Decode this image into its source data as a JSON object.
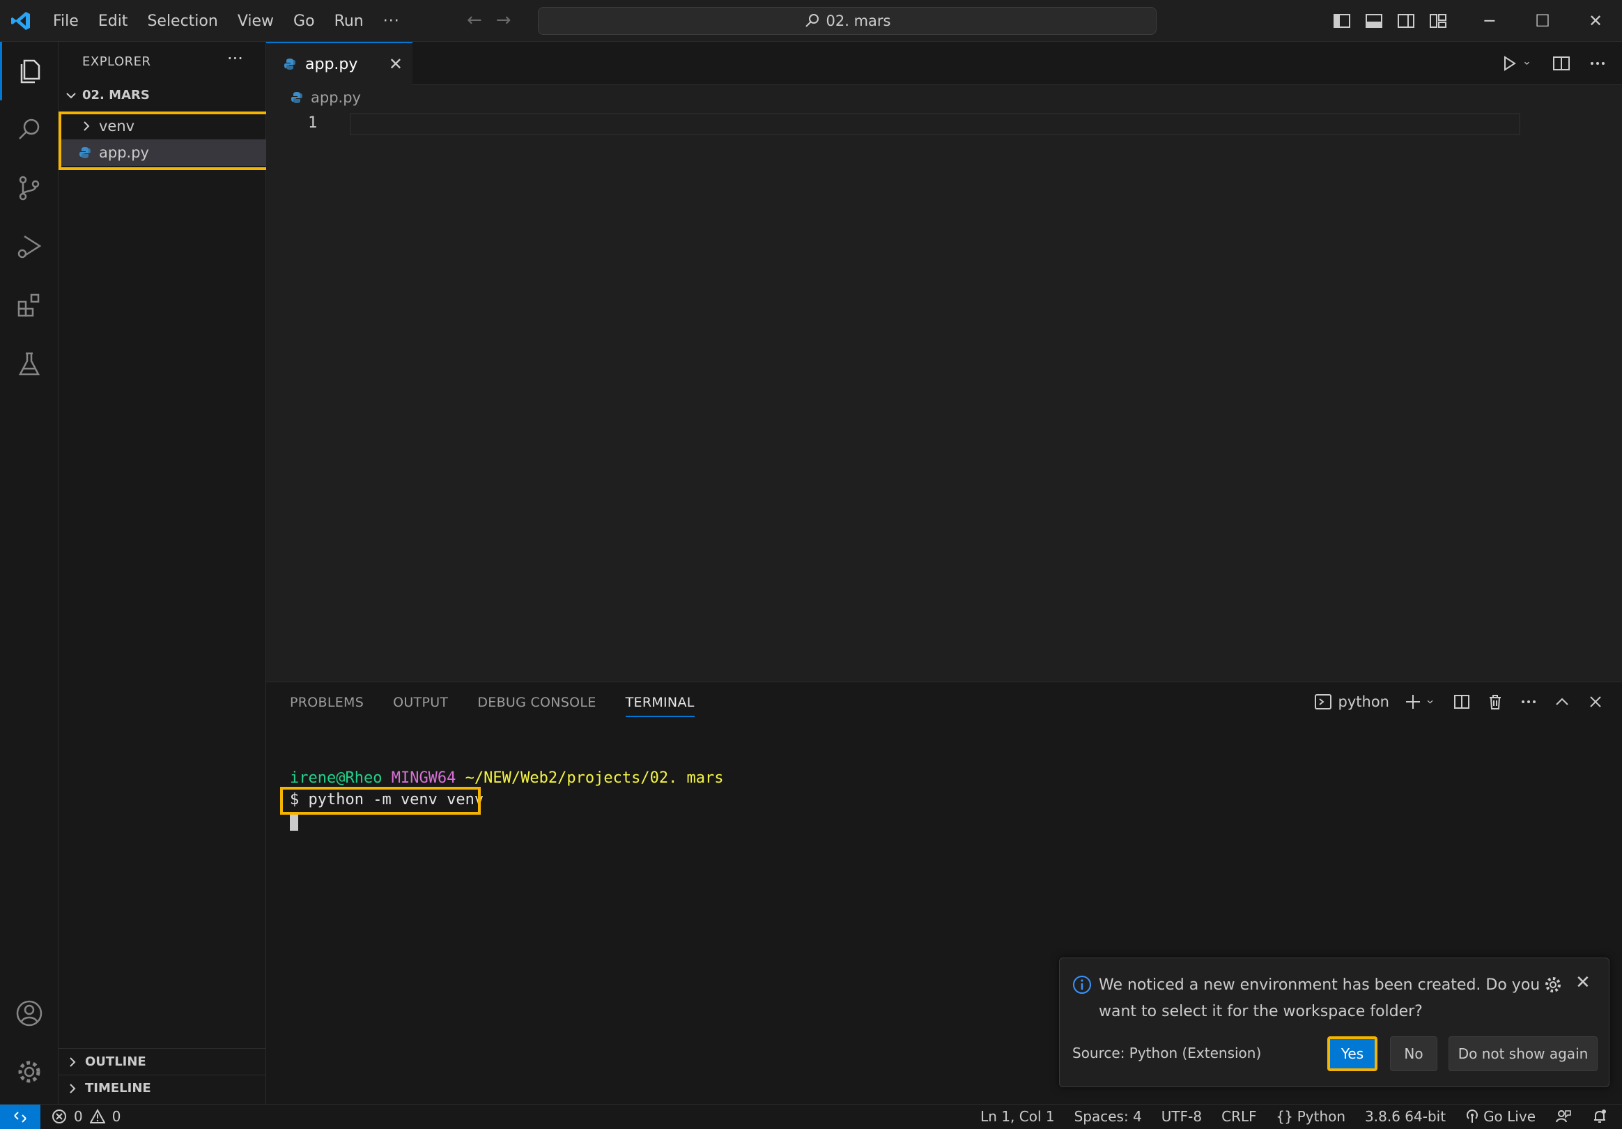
{
  "titlebar": {
    "menu": [
      "File",
      "Edit",
      "Selection",
      "View",
      "Go",
      "Run"
    ],
    "more": "···",
    "search_text": "02. mars",
    "nav_back": "←",
    "nav_forward": "→",
    "minimize": "─",
    "maximize": "☐",
    "close": "✕"
  },
  "sidebar": {
    "title": "EXPLORER",
    "more": "···",
    "folder": "02. MARS",
    "items": [
      {
        "label": "venv",
        "type": "folder"
      },
      {
        "label": "app.py",
        "type": "file",
        "selected": true
      }
    ],
    "outline": "OUTLINE",
    "timeline": "TIMELINE"
  },
  "editor": {
    "tab_label": "app.py",
    "tab_close": "✕",
    "breadcrumb": "app.py",
    "line_number": "1"
  },
  "panel": {
    "tabs": [
      "PROBLEMS",
      "OUTPUT",
      "DEBUG CONSOLE",
      "TERMINAL"
    ],
    "active_tab": "TERMINAL",
    "terminal_name": "python",
    "terminal": {
      "user": "irene@Rheo",
      "host": "MINGW64",
      "path": "~/NEW/Web2/projects/02. mars",
      "command": "$ python -m venv venv"
    }
  },
  "notification": {
    "message": "We noticed a new environment has been created. Do you want to select it for the workspace folder?",
    "source": "Source: Python (Extension)",
    "yes": "Yes",
    "no": "No",
    "dont_show": "Do not show again",
    "close": "✕"
  },
  "statusbar": {
    "errors": "0",
    "warnings": "0",
    "position": "Ln 1, Col 1",
    "spaces": "Spaces: 4",
    "encoding": "UTF-8",
    "eol": "CRLF",
    "language": "Python",
    "interpreter": "3.8.6 64-bit",
    "go_live": "Go Live"
  },
  "colors": {
    "accent": "#0078d4",
    "highlight": "#f5b400",
    "terminal_user": "#23d18b",
    "terminal_host": "#d670d6",
    "terminal_path": "#f5f543"
  }
}
